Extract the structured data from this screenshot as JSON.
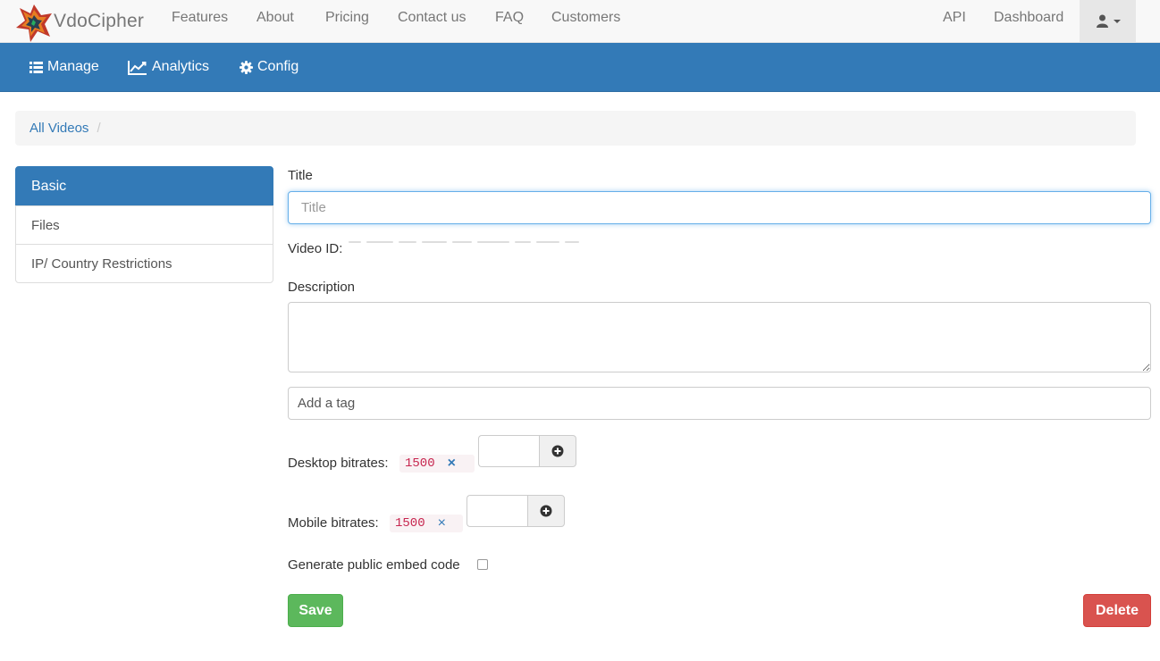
{
  "brand": {
    "name": "VdoCipher"
  },
  "topnav": {
    "items": [
      "Features",
      "About",
      "Pricing",
      "Contact us",
      "FAQ",
      "Customers"
    ],
    "right_items": [
      "API",
      "Dashboard"
    ]
  },
  "subnav": {
    "manage": "Manage",
    "analytics": "Analytics",
    "config": "Config"
  },
  "breadcrumb": {
    "link": "All Videos",
    "separator": "/"
  },
  "sidebar": {
    "items": [
      "Basic",
      "Files",
      "IP/ Country Restrictions"
    ]
  },
  "form": {
    "title_label": "Title",
    "title_placeholder": "Title",
    "video_id_label": "Video ID:",
    "description_label": "Description",
    "tag_placeholder": "Add a tag",
    "desktop_label": "Desktop bitrates:",
    "desktop_bitrate": "1500",
    "mobile_label": "Mobile bitrates:",
    "mobile_bitrate": "1500",
    "chip_remove": "×",
    "embed_label": "Generate public embed code",
    "save": "Save",
    "delete": "Delete"
  },
  "colors": {
    "primary": "#337ab7",
    "success": "#5cb85c",
    "danger": "#d9534f"
  },
  "icons": [
    "list-icon",
    "line-chart-icon",
    "gear-icon",
    "user-icon",
    "plus-circle-icon",
    "remove-icon"
  ]
}
